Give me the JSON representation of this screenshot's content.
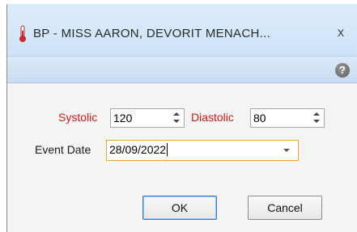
{
  "window": {
    "title": "BP - MISS AARON, DEVORIT MENACH...",
    "close_glyph": "x",
    "help_glyph": "?"
  },
  "form": {
    "systolic_label": "Systolic",
    "systolic_value": "120",
    "diastolic_label": "Diastolic",
    "diastolic_value": "80",
    "event_date_label": "Event Date",
    "event_date_value": "28/09/2022"
  },
  "buttons": {
    "ok_label": "OK",
    "cancel_label": "Cancel"
  },
  "colors": {
    "required_label": "#d11a1a",
    "focus_border": "#e8a33a",
    "default_button_border": "#2c7cd3"
  },
  "icons": {
    "title": "thermometer-icon",
    "help": "help-icon",
    "close": "close-icon"
  }
}
